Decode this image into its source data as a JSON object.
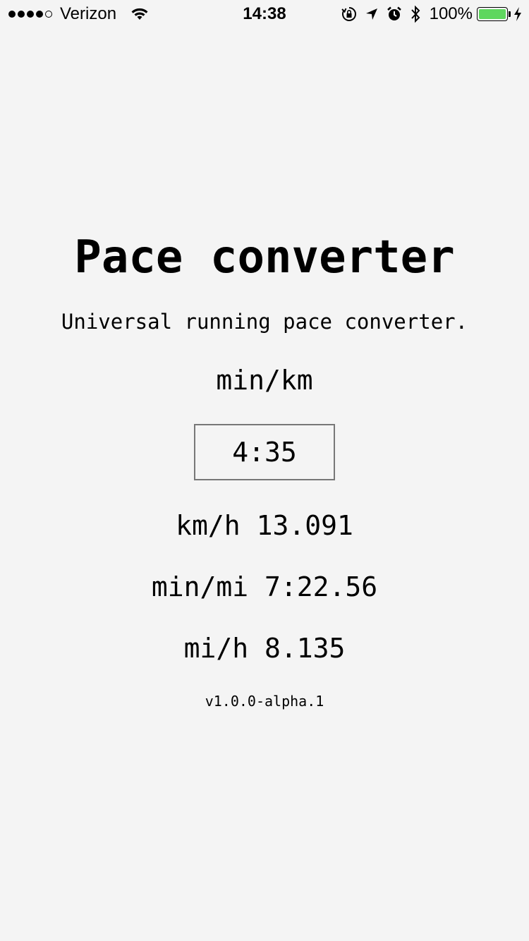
{
  "status_bar": {
    "signal_bars": 4,
    "signal_max": 5,
    "carrier": "Verizon",
    "time": "14:38",
    "battery_percent_label": "100%",
    "battery_level": 1.0,
    "battery_color": "#5fd75f",
    "icons": [
      "wifi-icon",
      "orientation-lock-icon",
      "location-arrow-icon",
      "alarm-icon",
      "bluetooth-icon",
      "battery-icon",
      "charging-bolt-icon"
    ]
  },
  "app": {
    "title": "Pace converter",
    "subtitle": "Universal running pace converter.",
    "input_unit_label": "min/km",
    "input_value": "4:35",
    "results": [
      {
        "unit": "km/h",
        "value": "13.091"
      },
      {
        "unit": "min/mi",
        "value": "7:22.56"
      },
      {
        "unit": "mi/h",
        "value": "8.135"
      }
    ],
    "version": "v1.0.0-alpha.1"
  },
  "colors": {
    "background": "#f4f4f4",
    "text": "#000000",
    "input_border": "#777777"
  }
}
